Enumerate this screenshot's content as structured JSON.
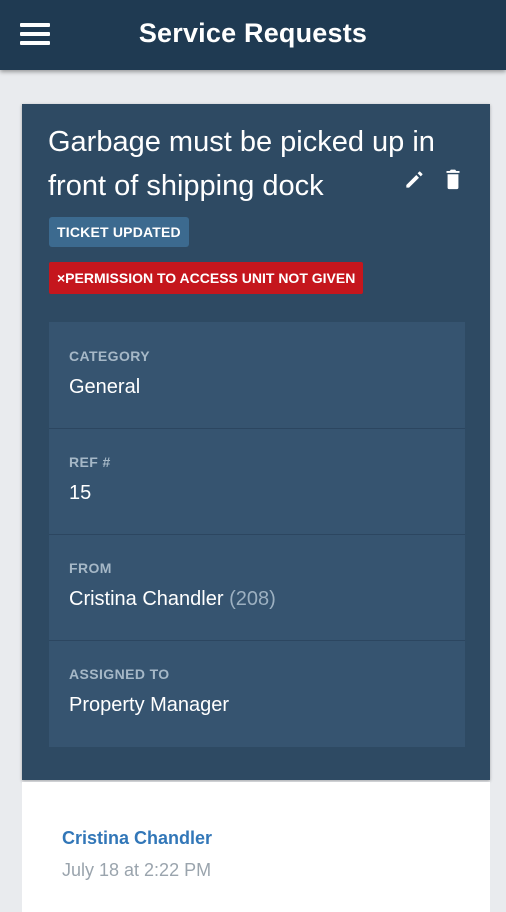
{
  "header": {
    "title": "Service Requests",
    "menu_icon": "hamburger-menu-icon"
  },
  "ticket": {
    "title": "Garbage must be picked up in front of shipping dock",
    "edit_icon": "pencil-icon",
    "delete_icon": "trash-icon",
    "status_badge": "TICKET UPDATED",
    "permission_badge": "×PERMISSION TO ACCESS UNIT NOT GIVEN",
    "details": {
      "category": {
        "label": "CATEGORY",
        "value": "General"
      },
      "ref": {
        "label": "REF #",
        "value": "15"
      },
      "from": {
        "label": "FROM",
        "value": "Cristina Chandler",
        "unit": "(208)"
      },
      "assigned": {
        "label": "ASSIGNED TO",
        "value": "Property Manager"
      }
    }
  },
  "comment": {
    "author": "Cristina Chandler",
    "timestamp": "July 18 at 2:22 PM"
  },
  "colors": {
    "appbar": "#1f3a52",
    "card": "#2e4a63",
    "details_panel": "#365470",
    "badge_updated": "#3c6a8f",
    "badge_permission": "#c5161d",
    "link": "#3277b8"
  }
}
